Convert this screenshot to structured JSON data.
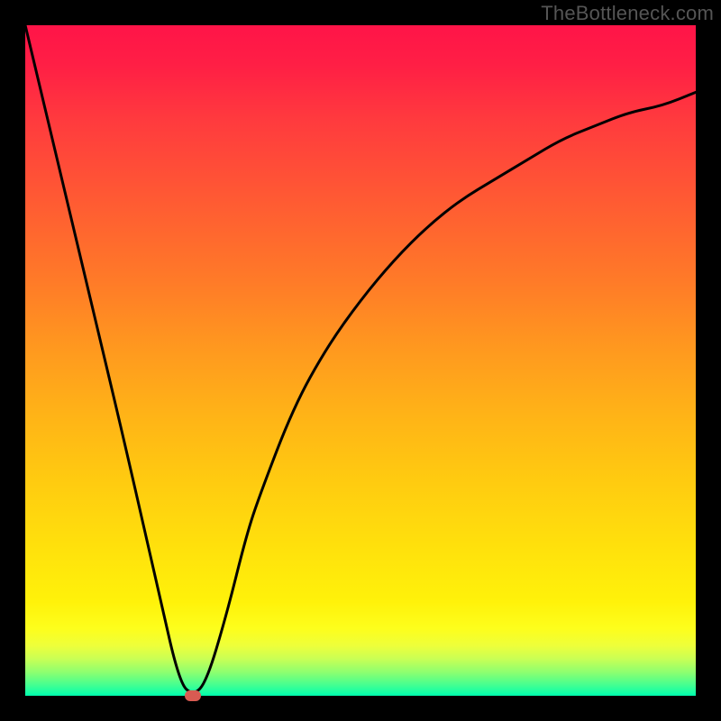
{
  "watermark": "TheBottleneck.com",
  "chart_data": {
    "type": "line",
    "title": "",
    "xlabel": "",
    "ylabel": "",
    "xlim": [
      0,
      100
    ],
    "ylim": [
      0,
      100
    ],
    "grid": false,
    "legend": false,
    "series": [
      {
        "name": "curve",
        "x": [
          0,
          5,
          10,
          15,
          20,
          23,
          25,
          27,
          30,
          33,
          35,
          40,
          45,
          50,
          55,
          60,
          65,
          70,
          75,
          80,
          85,
          90,
          95,
          100
        ],
        "values": [
          100,
          79,
          58,
          37,
          15,
          2,
          0,
          2,
          12,
          24,
          30,
          43,
          52,
          59,
          65,
          70,
          74,
          77,
          80,
          83,
          85,
          87,
          88,
          90
        ]
      }
    ],
    "marker": {
      "x": 25,
      "y": 0
    },
    "curve_stroke": "#000000",
    "curve_stroke_width": 3,
    "marker_color": "#d95b52",
    "gradient_stops": [
      {
        "pos": 0,
        "color": "#ff1448"
      },
      {
        "pos": 50,
        "color": "#ffa020"
      },
      {
        "pos": 85,
        "color": "#fff20a"
      },
      {
        "pos": 100,
        "color": "#00ffae"
      }
    ]
  }
}
